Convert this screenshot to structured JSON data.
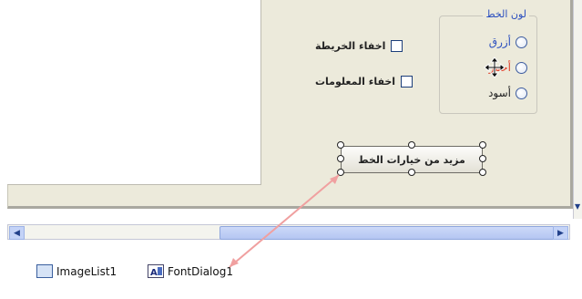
{
  "form": {
    "group_title": "لون الخط",
    "radios": [
      {
        "label": "أزرق",
        "color": "#2b4fbf"
      },
      {
        "label": "أحمر",
        "color": "#e0402a"
      },
      {
        "label": "أسود",
        "color": "#222222"
      }
    ],
    "checkboxes": [
      {
        "label": "اخفاء الخريطة"
      },
      {
        "label": "اخفاء المعلومات"
      }
    ],
    "more_button": "مزيد من خيارات الخط"
  },
  "tray": {
    "items": [
      {
        "label": "ImageList1",
        "icon": "imagelist-icon"
      },
      {
        "label": "FontDialog1",
        "icon": "fontdialog-icon"
      }
    ]
  },
  "colors": {
    "annotation_arrow": "#f0a0a0"
  }
}
